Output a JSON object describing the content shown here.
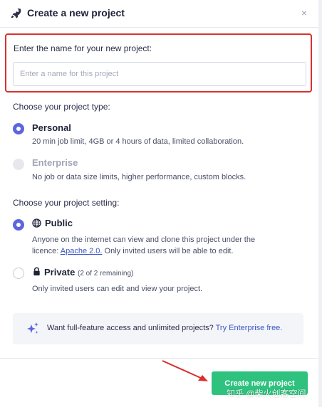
{
  "header": {
    "title": "Create a new project",
    "close_glyph": "×",
    "icon": "rocket-icon"
  },
  "name_field": {
    "label": "Enter the name for your new project:",
    "value": "",
    "placeholder": "Enter a name for this project"
  },
  "project_type": {
    "label": "Choose your project type:",
    "options": [
      {
        "title": "Personal",
        "description": "20 min job limit, 4GB or 4 hours of data, limited collaboration.",
        "selected": true,
        "disabled": false
      },
      {
        "title": "Enterprise",
        "description": "No job or data size limits, higher performance, custom blocks.",
        "selected": false,
        "disabled": true
      }
    ]
  },
  "project_setting": {
    "label": "Choose your project setting:",
    "options": [
      {
        "title": "Public",
        "icon": "globe-icon",
        "description_part1": "Anyone on the internet can view and clone this project under the",
        "description_part2_prefix": "licence: ",
        "licence_link": "Apache 2.0.",
        "description_part2_suffix": " Only invited users will be able to edit.",
        "selected": true
      },
      {
        "title": "Private",
        "icon": "lock-icon",
        "remaining": "(2 of 2 remaining)",
        "description": "Only invited users can edit and view your project.",
        "selected": false
      }
    ]
  },
  "info": {
    "icon": "sparkle-stars-icon",
    "text": "Want full-feature access and unlimited projects? ",
    "link": "Try Enterprise free."
  },
  "footer": {
    "create_label": "Create new project"
  },
  "annotation": {
    "highlight_color": "#d9302e",
    "arrow_color": "#d9302e"
  },
  "watermark": "知乎 @柴火创客空间",
  "colors": {
    "accent": "#5b66e0",
    "primary_button": "#2ec27e",
    "link": "#3b55c4"
  }
}
